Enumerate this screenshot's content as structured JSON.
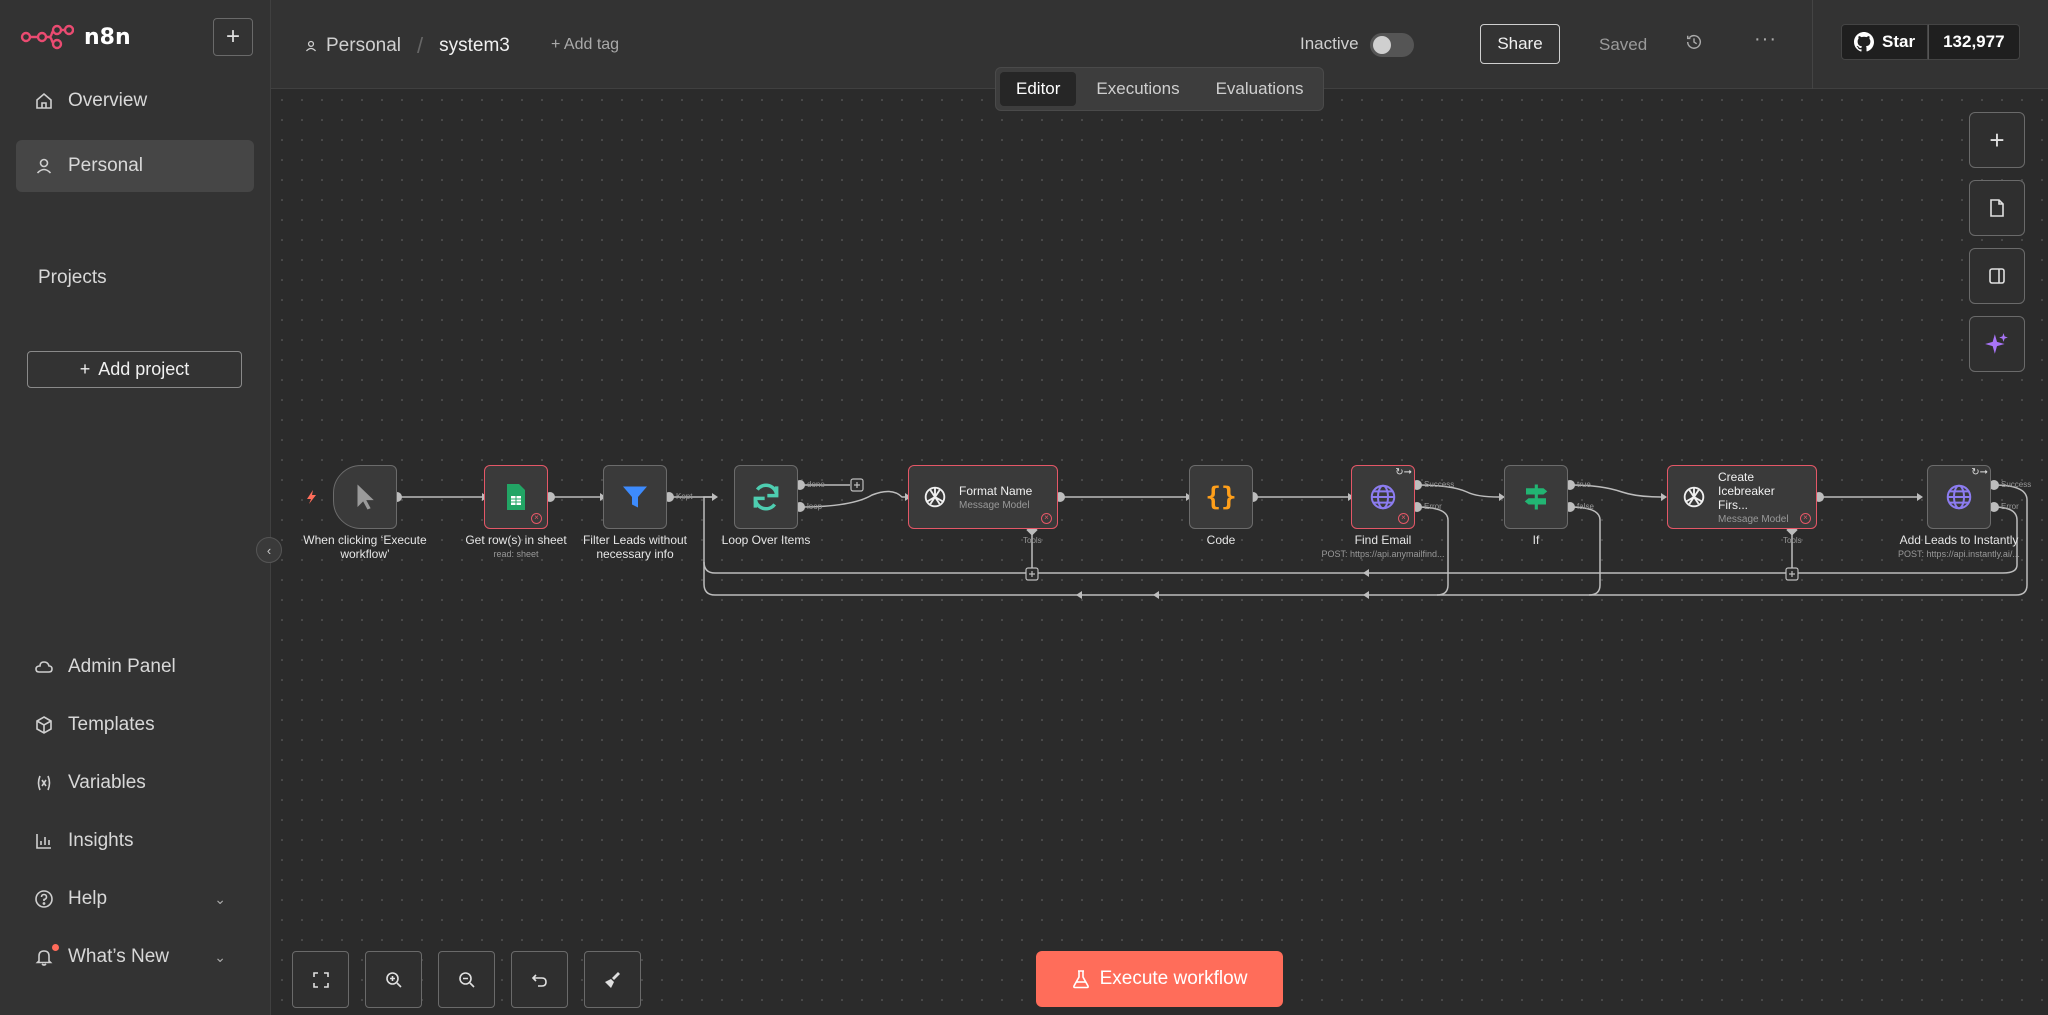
{
  "app": {
    "name": "n8n"
  },
  "sidebar": {
    "items": [
      {
        "label": "Overview",
        "icon": "home-icon"
      },
      {
        "label": "Personal",
        "icon": "user-icon",
        "active": true
      }
    ],
    "projects_heading": "Projects",
    "add_project_label": "Add project",
    "bottom_items": [
      {
        "label": "Admin Panel",
        "icon": "cloud-icon"
      },
      {
        "label": "Templates",
        "icon": "box-icon"
      },
      {
        "label": "Variables",
        "icon": "variable-icon"
      },
      {
        "label": "Insights",
        "icon": "chart-icon"
      },
      {
        "label": "Help",
        "icon": "help-icon"
      },
      {
        "label": "What’s New",
        "icon": "bell-icon"
      }
    ]
  },
  "header": {
    "breadcrumb_project": "Personal",
    "workflow_name": "system3",
    "add_tag": "+ Add tag",
    "status": "Inactive",
    "share": "Share",
    "saved": "Saved",
    "github_star": "Star",
    "github_count": "132,977"
  },
  "tabs": [
    "Editor",
    "Executions",
    "Evaluations"
  ],
  "active_tab": "Editor",
  "nodes": {
    "trigger": {
      "label": "When clicking ‘Execute workflow’"
    },
    "sheet": {
      "label": "Get row(s) in sheet",
      "sub": "read: sheet"
    },
    "filter": {
      "label": "Filter Leads without necessary info",
      "port": "Kept"
    },
    "loop": {
      "label": "Loop Over Items",
      "port_done": "done",
      "port_loop": "loop"
    },
    "format": {
      "title": "Format Name",
      "sub": "Message Model",
      "tools": "Tools"
    },
    "code": {
      "label": "Code"
    },
    "find_email": {
      "label": "Find Email",
      "sub": "POST: https://api.anymailfind...",
      "port_success": "Success",
      "port_error": "Error"
    },
    "if": {
      "label": "If",
      "port_true": "true",
      "port_false": "false"
    },
    "icebreaker": {
      "title": "Create Icebreaker Firs...",
      "sub": "Message Model",
      "tools": "Tools"
    },
    "instantly": {
      "label": "Add Leads to Instantly",
      "sub": "POST: https://api.instantly.ai/...",
      "port_success": "Success",
      "port_error": "Error"
    }
  },
  "execute_button": "Execute workflow",
  "colors": {
    "accent": "#ff6d5a",
    "error": "#e45767",
    "canvas": "#2b2b2b"
  }
}
